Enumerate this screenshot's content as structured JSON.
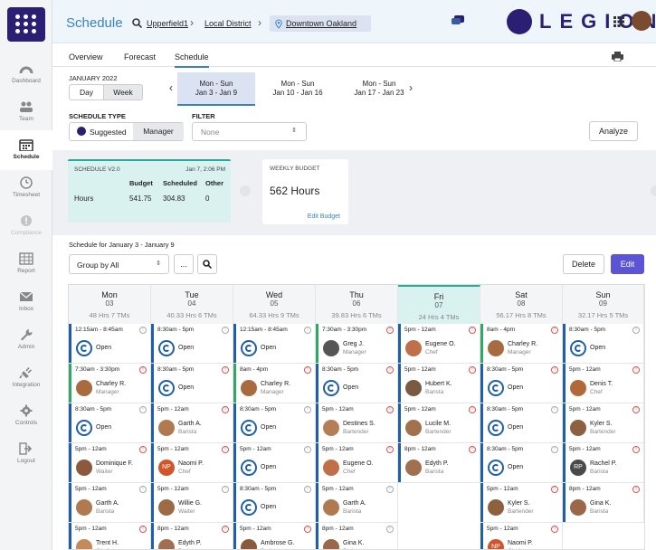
{
  "sidebar": {
    "items": [
      {
        "label": "Dashboard",
        "icon": "dashboard-icon",
        "active": false,
        "disabled": false
      },
      {
        "label": "Team",
        "icon": "team-icon",
        "active": false,
        "disabled": false
      },
      {
        "label": "Schedule",
        "icon": "calendar-icon",
        "active": true,
        "disabled": false
      },
      {
        "label": "Timesheet",
        "icon": "clock-icon",
        "active": false,
        "disabled": false
      },
      {
        "label": "Compliance",
        "icon": "alert-icon",
        "active": false,
        "disabled": true
      },
      {
        "label": "Report",
        "icon": "table-icon",
        "active": false,
        "disabled": false
      },
      {
        "label": "Inbox",
        "icon": "mail-icon",
        "active": false,
        "disabled": false
      },
      {
        "label": "Admin",
        "icon": "wrench-icon",
        "active": false,
        "disabled": false
      },
      {
        "label": "Integration",
        "icon": "plug-icon",
        "active": false,
        "disabled": false
      },
      {
        "label": "Controls",
        "icon": "gear-icon",
        "active": false,
        "disabled": false
      },
      {
        "label": "Logout",
        "icon": "logout-icon",
        "active": false,
        "disabled": false
      }
    ]
  },
  "header": {
    "title": "Schedule",
    "bc1": "Upperfield1",
    "bc2": "Local District",
    "bc3": "Downtown Oakland",
    "brand": "LEGION"
  },
  "tabs": [
    "Overview",
    "Forecast",
    "Schedule"
  ],
  "period": {
    "month": "JANUARY 2022",
    "day_label": "Day",
    "week_label": "Week"
  },
  "weeks": [
    {
      "range": "Mon - Sun",
      "dates": "Jan 3 - Jan 9",
      "selected": true
    },
    {
      "range": "Mon - Sun",
      "dates": "Jan 10 - Jan 16",
      "selected": false
    },
    {
      "range": "Mon - Sun",
      "dates": "Jan 17 - Jan 23",
      "selected": false
    }
  ],
  "schedule_type": {
    "label": "SCHEDULE TYPE",
    "suggested": "Suggested",
    "manager": "Manager"
  },
  "filter": {
    "label": "FILTER",
    "value": "None"
  },
  "analyze": "Analyze",
  "summary": {
    "title": "SCHEDULE V2.0",
    "timestamp": "Jan 7, 2:06 PM",
    "col1": "Budget",
    "col2": "Scheduled",
    "col3": "Other",
    "row_label": "Hours",
    "budget": "541.75",
    "scheduled": "304.83",
    "other": "0"
  },
  "weekly_budget": {
    "title": "WEEKLY BUDGET",
    "value": "562 Hours",
    "edit": "Edit Budget"
  },
  "schedule_for": "Schedule for January 3 - January 9",
  "group_by": "Group by All",
  "more": "...",
  "delete_label": "Delete",
  "edit_label": "Edit",
  "colors": {
    "accent": "#3b82c4",
    "brand": "#2a1f73",
    "highlight": "#d9f1ef",
    "selected_week": "#dbe3f2"
  },
  "days": [
    {
      "name": "Mon",
      "date": "03",
      "stats": "48 Hrs  7 TMs",
      "shifts": [
        {
          "time": "12:15am - 8:45am",
          "name": "Open",
          "role": "",
          "bar": "#1f5fa8",
          "av": "open",
          "info": "grey"
        },
        {
          "time": "7:30am - 3:30pm",
          "name": "Charley R.",
          "role": "Manager",
          "bar": "#2fa866",
          "av": "#a86b3f",
          "info": "red"
        },
        {
          "time": "8:30am - 5pm",
          "name": "Open",
          "role": "",
          "bar": "#1f5fa8",
          "av": "open",
          "info": "grey"
        },
        {
          "time": "5pm - 12am",
          "name": "Dominique F.",
          "role": "Waiter",
          "bar": "#1f5fa8",
          "av": "#8b5a3c",
          "info": "red"
        },
        {
          "time": "5pm - 12am",
          "name": "Garth A.",
          "role": "Barista",
          "bar": "#1f5fa8",
          "av": "#b07a50",
          "info": "grey"
        },
        {
          "time": "5pm - 12am",
          "name": "Trent H.",
          "role": "Chef",
          "bar": "#1f5fa8",
          "av": "#c58a5a",
          "info": "red"
        }
      ]
    },
    {
      "name": "Tue",
      "date": "04",
      "stats": "40.33 Hrs  6 TMs",
      "shifts": [
        {
          "time": "8:30am - 5pm",
          "name": "Open",
          "role": "",
          "bar": "#1f5fa8",
          "av": "open",
          "info": "grey"
        },
        {
          "time": "8:30am - 5pm",
          "name": "Open",
          "role": "",
          "bar": "#1f5fa8",
          "av": "open",
          "info": "red"
        },
        {
          "time": "5pm - 12am",
          "name": "Garth A.",
          "role": "Barista",
          "bar": "#1f5fa8",
          "av": "#b07a50",
          "info": "red"
        },
        {
          "time": "5pm - 12am",
          "name": "Naomi P.",
          "role": "Chef",
          "bar": "#1f5fa8",
          "av": "NP",
          "info": "red"
        },
        {
          "time": "5pm - 12am",
          "name": "Willie G.",
          "role": "Waiter",
          "bar": "#1f5fa8",
          "av": "#9c6a44",
          "info": "grey"
        },
        {
          "time": "8pm - 12am",
          "name": "Edyth P.",
          "role": "Barista",
          "bar": "#1f5fa8",
          "av": "#a07050",
          "info": "red"
        }
      ]
    },
    {
      "name": "Wed",
      "date": "05",
      "stats": "64.33 Hrs  9 TMs",
      "shifts": [
        {
          "time": "12:15am - 8:45am",
          "name": "Open",
          "role": "",
          "bar": "#1f5fa8",
          "av": "open",
          "info": "grey"
        },
        {
          "time": "8am - 4pm",
          "name": "Charley R.",
          "role": "Manager",
          "bar": "#2fa866",
          "av": "#a86b3f",
          "info": "red"
        },
        {
          "time": "8:30am - 5pm",
          "name": "Open",
          "role": "",
          "bar": "#1f5fa8",
          "av": "open",
          "info": "grey"
        },
        {
          "time": "5pm - 12am",
          "name": "Open",
          "role": "",
          "bar": "#1f5fa8",
          "av": "open",
          "info": "grey"
        },
        {
          "time": "8:30am - 5pm",
          "name": "Open",
          "role": "",
          "bar": "#1f5fa8",
          "av": "open",
          "info": "grey"
        },
        {
          "time": "5pm - 12am",
          "name": "Ambrose G.",
          "role": "Barista",
          "bar": "#1f5fa8",
          "av": "#8a5a3a",
          "info": "red"
        }
      ]
    },
    {
      "name": "Thu",
      "date": "06",
      "stats": "39.83 Hrs  6 TMs",
      "shifts": [
        {
          "time": "7:30am - 3:30pm",
          "name": "Greg J.",
          "role": "Manager",
          "bar": "#2fa866",
          "av": "#555555",
          "info": "red"
        },
        {
          "time": "8:30am - 5pm",
          "name": "Open",
          "role": "",
          "bar": "#1f5fa8",
          "av": "open",
          "info": "red"
        },
        {
          "time": "5pm - 12am",
          "name": "Destines S.",
          "role": "Bartender",
          "bar": "#1f5fa8",
          "av": "#b57e55",
          "info": "red"
        },
        {
          "time": "5pm - 12am",
          "name": "Eugene O.",
          "role": "Chef",
          "bar": "#1f5fa8",
          "av": "#c07048",
          "info": "red"
        },
        {
          "time": "5pm - 12am",
          "name": "Garth A.",
          "role": "Barista",
          "bar": "#1f5fa8",
          "av": "#b07a50",
          "info": "grey"
        },
        {
          "time": "8pm - 12am",
          "name": "Gina K.",
          "role": "Barista",
          "bar": "#1f5fa8",
          "av": "#9a6848",
          "info": "grey"
        }
      ]
    },
    {
      "name": "Fri",
      "date": "07",
      "stats": "24 Hrs  4 TMs",
      "shifts": [
        {
          "time": "5pm - 12am",
          "name": "Eugene O.",
          "role": "Chef",
          "bar": "#1f5fa8",
          "av": "#c07048",
          "info": "red"
        },
        {
          "time": "5pm - 12am",
          "name": "Hubert K.",
          "role": "Barista",
          "bar": "#1f5fa8",
          "av": "#7a5a42",
          "info": "red"
        },
        {
          "time": "5pm - 12am",
          "name": "Lucile M.",
          "role": "Bartender",
          "bar": "#1f5fa8",
          "av": "#a2704a",
          "info": "red"
        },
        {
          "time": "8pm - 12am",
          "name": "Edyth P.",
          "role": "Barista",
          "bar": "#1f5fa8",
          "av": "#a07050",
          "info": "red"
        }
      ]
    },
    {
      "name": "Sat",
      "date": "08",
      "stats": "56.17 Hrs  8 TMs",
      "shifts": [
        {
          "time": "8am - 4pm",
          "name": "Charley R.",
          "role": "Manager",
          "bar": "#2fa866",
          "av": "#a86b3f",
          "info": "red"
        },
        {
          "time": "8:30am - 5pm",
          "name": "Open",
          "role": "",
          "bar": "#1f5fa8",
          "av": "open",
          "info": "red"
        },
        {
          "time": "8:30am - 5pm",
          "name": "Open",
          "role": "",
          "bar": "#1f5fa8",
          "av": "open",
          "info": "grey"
        },
        {
          "time": "8:30am - 5pm",
          "name": "Open",
          "role": "",
          "bar": "#1f5fa8",
          "av": "open",
          "info": "grey"
        },
        {
          "time": "5pm - 12am",
          "name": "Kyler S.",
          "role": "Bartender",
          "bar": "#1f5fa8",
          "av": "#8d6040",
          "info": "red"
        },
        {
          "time": "5pm - 12am",
          "name": "Naomi P.",
          "role": "Chef",
          "bar": "#1f5fa8",
          "av": "NP",
          "info": "red"
        }
      ]
    },
    {
      "name": "Sun",
      "date": "09",
      "stats": "32.17 Hrs  5 TMs",
      "shifts": [
        {
          "time": "8:30am - 5pm",
          "name": "Open",
          "role": "",
          "bar": "#1f5fa8",
          "av": "open",
          "info": "grey"
        },
        {
          "time": "5pm - 12am",
          "name": "Denis T.",
          "role": "Chef",
          "bar": "#1f5fa8",
          "av": "#b06a3a",
          "info": "red"
        },
        {
          "time": "5pm - 12am",
          "name": "Kyler S.",
          "role": "Bartender",
          "bar": "#1f5fa8",
          "av": "#8d6040",
          "info": "red"
        },
        {
          "time": "5pm - 12am",
          "name": "Rachel P.",
          "role": "Barista",
          "bar": "#1f5fa8",
          "av": "RP",
          "info": "red"
        },
        {
          "time": "8pm - 12am",
          "name": "Gina K.",
          "role": "Barista",
          "bar": "#1f5fa8",
          "av": "#9a6848",
          "info": "red"
        }
      ]
    }
  ]
}
